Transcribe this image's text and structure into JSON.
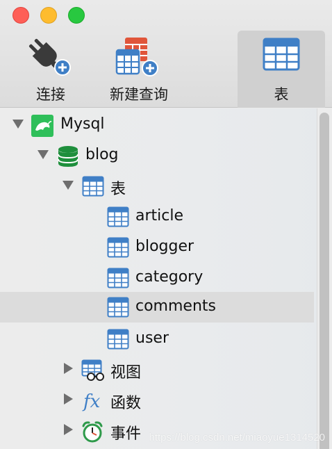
{
  "window": {
    "controls": [
      "close",
      "minimize",
      "zoom"
    ]
  },
  "toolbar": {
    "connect_label": "连接",
    "new_query_label": "新建查询",
    "tables_label": "表",
    "active_tool": "tables"
  },
  "tree": {
    "connection": {
      "label": "Mysql",
      "expanded": true,
      "icon": "mysql-connection-icon"
    },
    "database": {
      "label": "blog",
      "expanded": true,
      "icon": "database-icon"
    },
    "tables_group": {
      "label": "表",
      "expanded": true,
      "icon": "table-icon"
    },
    "tables": [
      {
        "label": "article"
      },
      {
        "label": "blogger"
      },
      {
        "label": "category"
      },
      {
        "label": "comments",
        "selected": true
      },
      {
        "label": "user"
      }
    ],
    "views_group": {
      "label": "视图",
      "expanded": false,
      "icon": "view-icon"
    },
    "functions_group": {
      "label": "函数",
      "expanded": false,
      "icon": "function-icon"
    },
    "events_group": {
      "label": "事件",
      "expanded": false,
      "icon": "event-clock-icon"
    }
  },
  "watermark": "https://blog.csdn.net/miaoyue1314520",
  "colors": {
    "accent_blue": "#3f7fc6",
    "database_green": "#1e8f3c",
    "mysql_green": "#2fbf5a",
    "query_red": "#e0553a",
    "selection": "#dcdcdc"
  }
}
